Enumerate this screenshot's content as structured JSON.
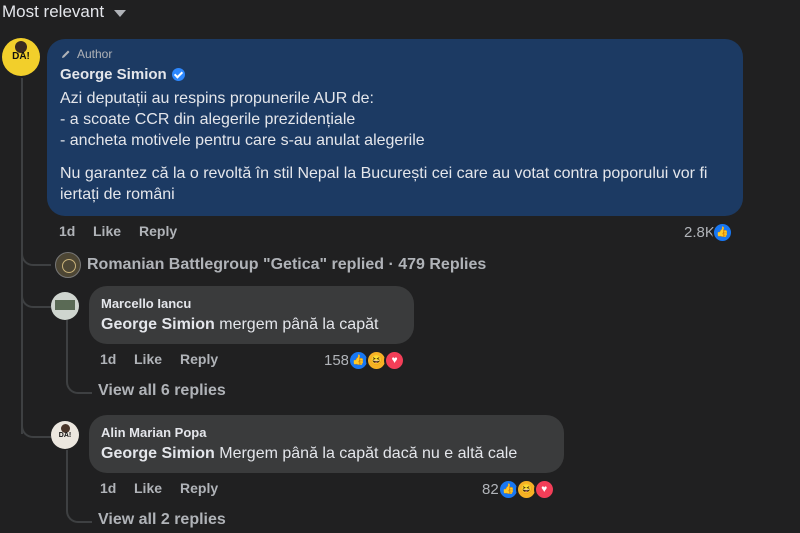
{
  "sort": {
    "label": "Most relevant"
  },
  "main_comment": {
    "author_badge": "Author",
    "name": "George Simion",
    "line1": "Azi deputații au respins propunerile AUR de:",
    "line2": "- a scoate CCR din alegerile prezidențiale",
    "line3": "- ancheta motivele pentru care s-au anulat alegerile",
    "line4": "Nu garantez că la o revoltă în stil Nepal la București cei care au votat contra poporului vor fi iertați de români",
    "avatar_text": "DA!",
    "time": "1d",
    "like": "Like",
    "reply": "Reply",
    "reaction_count": "2.8K"
  },
  "replied_summary": {
    "text": "Romanian Battlegroup \"Getica\" replied · 479 Replies"
  },
  "replies": [
    {
      "name": "Marcello Iancu",
      "mention": "George Simion",
      "text": " mergem până la capăt",
      "time": "1d",
      "like": "Like",
      "reply": "Reply",
      "reaction_count": "158",
      "view_all": "View all 6 replies"
    },
    {
      "name": "Alin Marian Popa",
      "mention": "George Simion",
      "text": " Mergem până la capăt dacă nu e altă cale",
      "avatar_text": "DA!",
      "time": "1d",
      "like": "Like",
      "reply": "Reply",
      "reaction_count": "82",
      "view_all": "View all 2 replies"
    }
  ]
}
